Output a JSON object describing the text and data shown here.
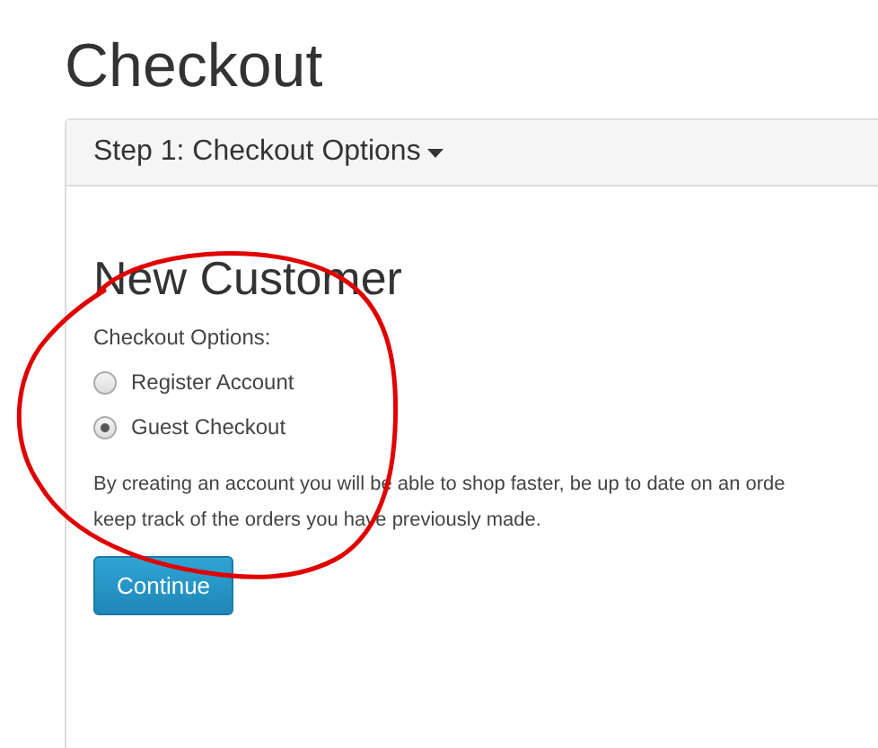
{
  "title": "Checkout",
  "panel": {
    "header": "Step 1: Checkout Options",
    "expanded": true,
    "heading": "New Customer",
    "options_label": "Checkout Options:",
    "options": [
      {
        "label": "Register Account",
        "selected": false
      },
      {
        "label": "Guest Checkout",
        "selected": true
      }
    ],
    "paragraph": [
      "By creating an account you will be able to shop faster, be up to date on an orde",
      "keep track of the orders you have previously made."
    ],
    "button": "Continue"
  }
}
